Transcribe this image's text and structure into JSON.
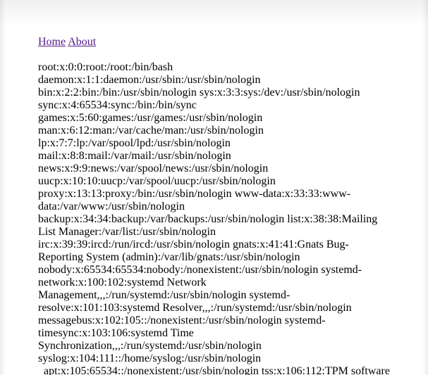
{
  "nav": {
    "home_label": "Home",
    "about_label": "About"
  },
  "colors": {
    "link_visited": "#551a8b",
    "text": "#000000",
    "background": "#ffffff"
  },
  "content": {
    "text": "root:x:0:0:root:/root:/bin/bash daemon:x:1:1:daemon:/usr/sbin:/usr/sbin/nologin bin:x:2:2:bin:/bin:/usr/sbin/nologin sys:x:3:3:sys:/dev:/usr/sbin/nologin sync:x:4:65534:sync:/bin:/bin/sync games:x:5:60:games:/usr/games:/usr/sbin/nologin man:x:6:12:man:/var/cache/man:/usr/sbin/nologin lp:x:7:7:lp:/var/spool/lpd:/usr/sbin/nologin mail:x:8:8:mail:/var/mail:/usr/sbin/nologin news:x:9:9:news:/var/spool/news:/usr/sbin/nologin uucp:x:10:10:uucp:/var/spool/uucp:/usr/sbin/nologin proxy:x:13:13:proxy:/bin:/usr/sbin/nologin www-data:x:33:33:www-data:/var/www:/usr/sbin/nologin backup:x:34:34:backup:/var/backups:/usr/sbin/nologin list:x:38:38:Mailing List Manager:/var/list:/usr/sbin/nologin irc:x:39:39:ircd:/run/ircd:/usr/sbin/nologin gnats:x:41:41:Gnats Bug-Reporting System (admin):/var/lib/gnats:/usr/sbin/nologin nobody:x:65534:65534:nobody:/nonexistent:/usr/sbin/nologin systemd-network:x:100:102:systemd Network Management,,,:/run/systemd:/usr/sbin/nologin systemd-resolve:x:101:103:systemd Resolver,,,:/run/systemd:/usr/sbin/nologin messagebus:x:102:105::/nonexistent:/usr/sbin/nologin systemd-timesync:x:103:106:systemd Time Synchronization,,,:/run/systemd:/usr/sbin/nologin syslog:x:104:111::/home/syslog:/usr/sbin/nologin _apt:x:105:65534::/nonexistent:/usr/sbin/nologin tss:x:106:112:TPM software"
  }
}
